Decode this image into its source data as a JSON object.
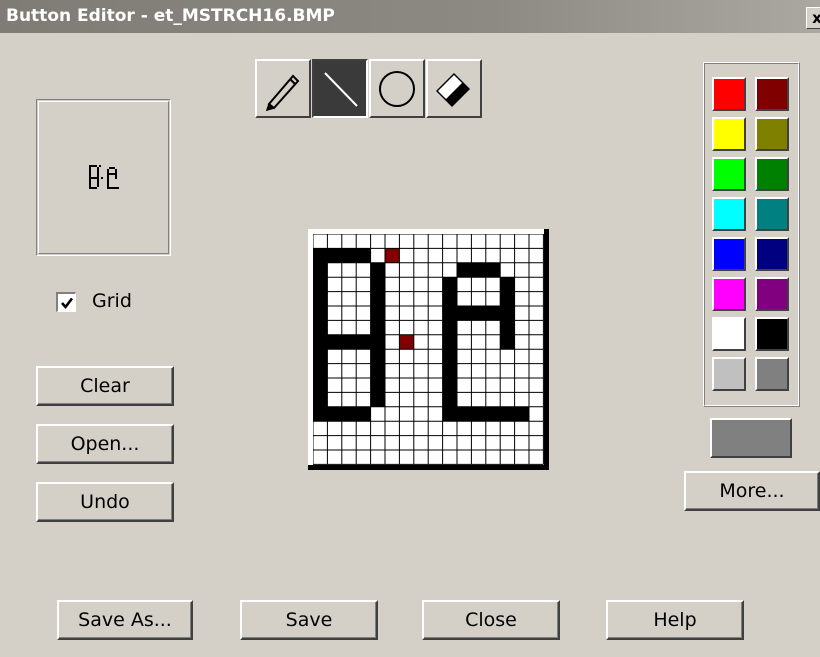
{
  "window": {
    "title": "Button Editor - et_MSTRCH16.BMP",
    "close_glyph": "x"
  },
  "tools": [
    {
      "name": "pencil-tool",
      "icon": "pencil-icon",
      "active": false
    },
    {
      "name": "line-tool",
      "icon": "line-icon",
      "active": true
    },
    {
      "name": "ellipse-tool",
      "icon": "ellipse-icon",
      "active": false
    },
    {
      "name": "eraser-tool",
      "icon": "eraser-icon",
      "active": false
    }
  ],
  "grid_option": {
    "label": "Grid",
    "checked": true
  },
  "side_buttons": {
    "clear": "Clear",
    "open": "Open...",
    "undo": "Undo"
  },
  "palette": {
    "colors": [
      "#ff0000",
      "#800000",
      "#ffff00",
      "#808000",
      "#00ff00",
      "#008000",
      "#00ffff",
      "#008080",
      "#0000ff",
      "#000080",
      "#ff00ff",
      "#800080",
      "#ffffff",
      "#000000",
      "#c0c0c0",
      "#808080"
    ],
    "current_color": "#808080",
    "more_label": "More..."
  },
  "bottom_buttons": {
    "save_as": "Save As...",
    "save": "Save",
    "close": "Close",
    "help": "Help"
  },
  "bitmap": {
    "size": 16,
    "legend": {
      ".": "#ffffff",
      "#": "#000000",
      "r": "#800000"
    },
    "rows": [
      "................",
      "####.r..........",
      "#...#.....###...",
      "#...#....#...#..",
      "#...#....#...#..",
      "#...#....#####..",
      "#...#....#...#..",
      "#####.r..#...#..",
      "#...#....#......",
      "#...#....#......",
      "#...#....#......",
      "#...#....#......",
      "####.....######.",
      "................",
      "................",
      "................"
    ]
  }
}
